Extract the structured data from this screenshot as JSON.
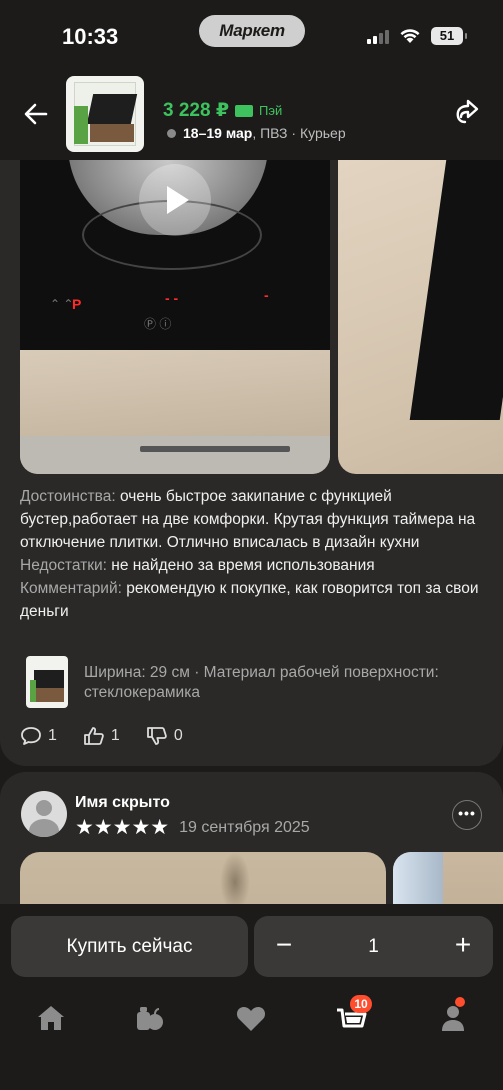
{
  "status": {
    "time": "10:33",
    "app_pill": "Маркет",
    "battery": "51"
  },
  "header": {
    "price": "3 228 ₽",
    "pay_label": "Пэй",
    "delivery_date": "18–19 мар",
    "delivery_options": ", ПВЗ · Курьер"
  },
  "review": {
    "pros_label": "Достоинства:",
    "pros_text": " очень быстрое закипание с функцией бустер,работает на две комфорки. Крутая функция таймера на отключение плитки. Отлично  вписалась в дизайн кухни",
    "cons_label": "Недостатки:",
    "cons_text": " не найдено за время использования",
    "comment_label": "Комментарий:",
    "comment_text": " рекомендую к покупке, как говорится топ за свои деньги",
    "variant": "Ширина: 29 см · Материал рабочей поверхности: стеклокерамика",
    "comments_count": "1",
    "likes_count": "1",
    "dislikes_count": "0"
  },
  "review2": {
    "author": "Имя скрыто",
    "stars": "★★★★★",
    "date": "19 сентября 2025",
    "more": "•••"
  },
  "buy": {
    "buy_label": "Купить сейчас",
    "minus": "−",
    "quantity": "1",
    "plus": "+"
  },
  "tabbar": {
    "cart_badge": "10"
  },
  "colors": {
    "accent_green": "#3dc25e",
    "badge_red": "#ff4d2e",
    "background": "#1c1b1a",
    "card": "#2a2927"
  }
}
